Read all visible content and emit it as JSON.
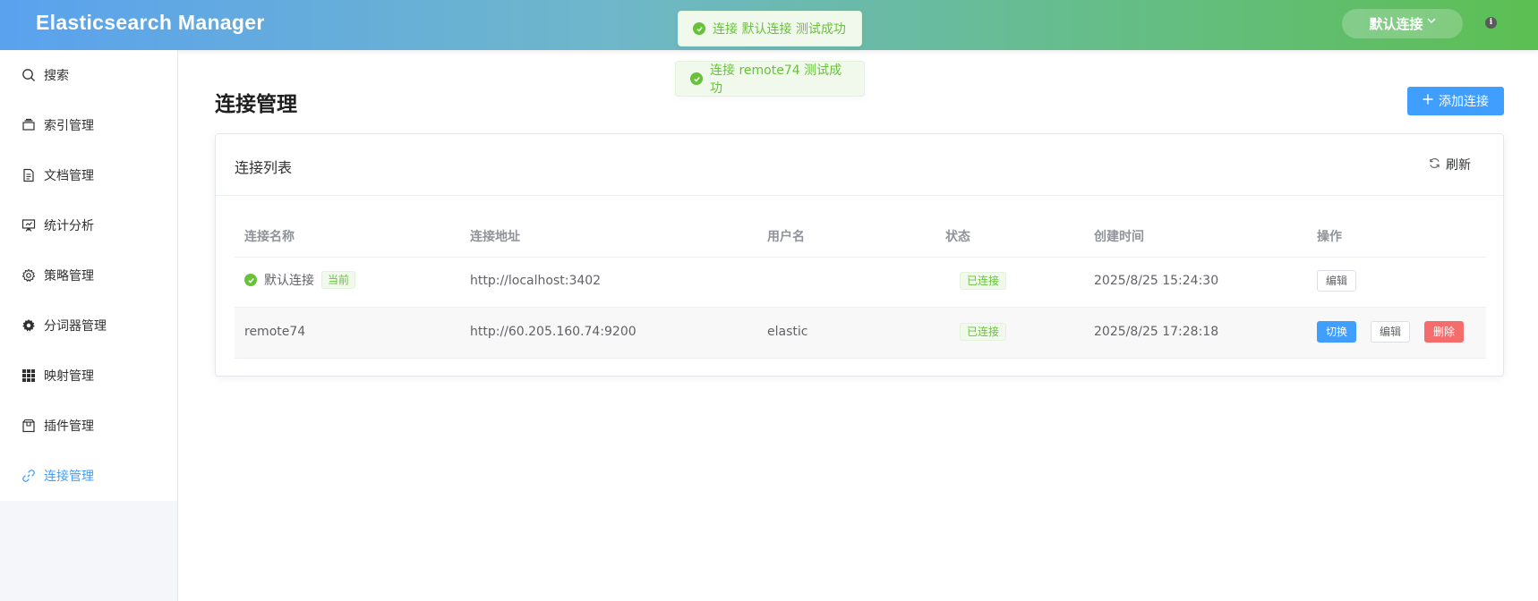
{
  "header": {
    "app_title": "Elasticsearch Manager",
    "current_connection": "默认连接",
    "info_glyph": "i"
  },
  "toasts": [
    {
      "message": "连接 默认连接 测试成功"
    },
    {
      "message": "连接 remote74 测试成功"
    }
  ],
  "sidebar": {
    "items": [
      {
        "label": "搜索",
        "icon": "search-icon"
      },
      {
        "label": "索引管理",
        "icon": "database-icon"
      },
      {
        "label": "文档管理",
        "icon": "document-icon"
      },
      {
        "label": "统计分析",
        "icon": "presentation-icon"
      },
      {
        "label": "策略管理",
        "icon": "gear-icon"
      },
      {
        "label": "分词器管理",
        "icon": "cog-solid-icon"
      },
      {
        "label": "映射管理",
        "icon": "grid-icon"
      },
      {
        "label": "插件管理",
        "icon": "package-icon"
      },
      {
        "label": "连接管理",
        "icon": "link-icon",
        "active": true
      }
    ]
  },
  "main": {
    "page_title": "连接管理",
    "add_button": "添加连接",
    "card": {
      "title": "连接列表",
      "refresh_label": "刷新"
    },
    "table": {
      "columns": [
        "连接名称",
        "连接地址",
        "用户名",
        "状态",
        "创建时间",
        "操作"
      ],
      "rows": [
        {
          "name": "默认连接",
          "current_tag": "当前",
          "url": "http://localhost:3402",
          "username": "",
          "status": "已连接",
          "created": "2025/8/25 15:24:30",
          "actions": {
            "edit": "编辑"
          }
        },
        {
          "name": "remote74",
          "url": "http://60.205.160.74:9200",
          "username": "elastic",
          "status": "已连接",
          "created": "2025/8/25 17:28:18",
          "actions": {
            "switch": "切换",
            "edit": "编辑",
            "delete": "删除"
          }
        }
      ]
    }
  },
  "colors": {
    "primary": "#409eff",
    "success": "#67c23a",
    "danger": "#f56c6c"
  }
}
